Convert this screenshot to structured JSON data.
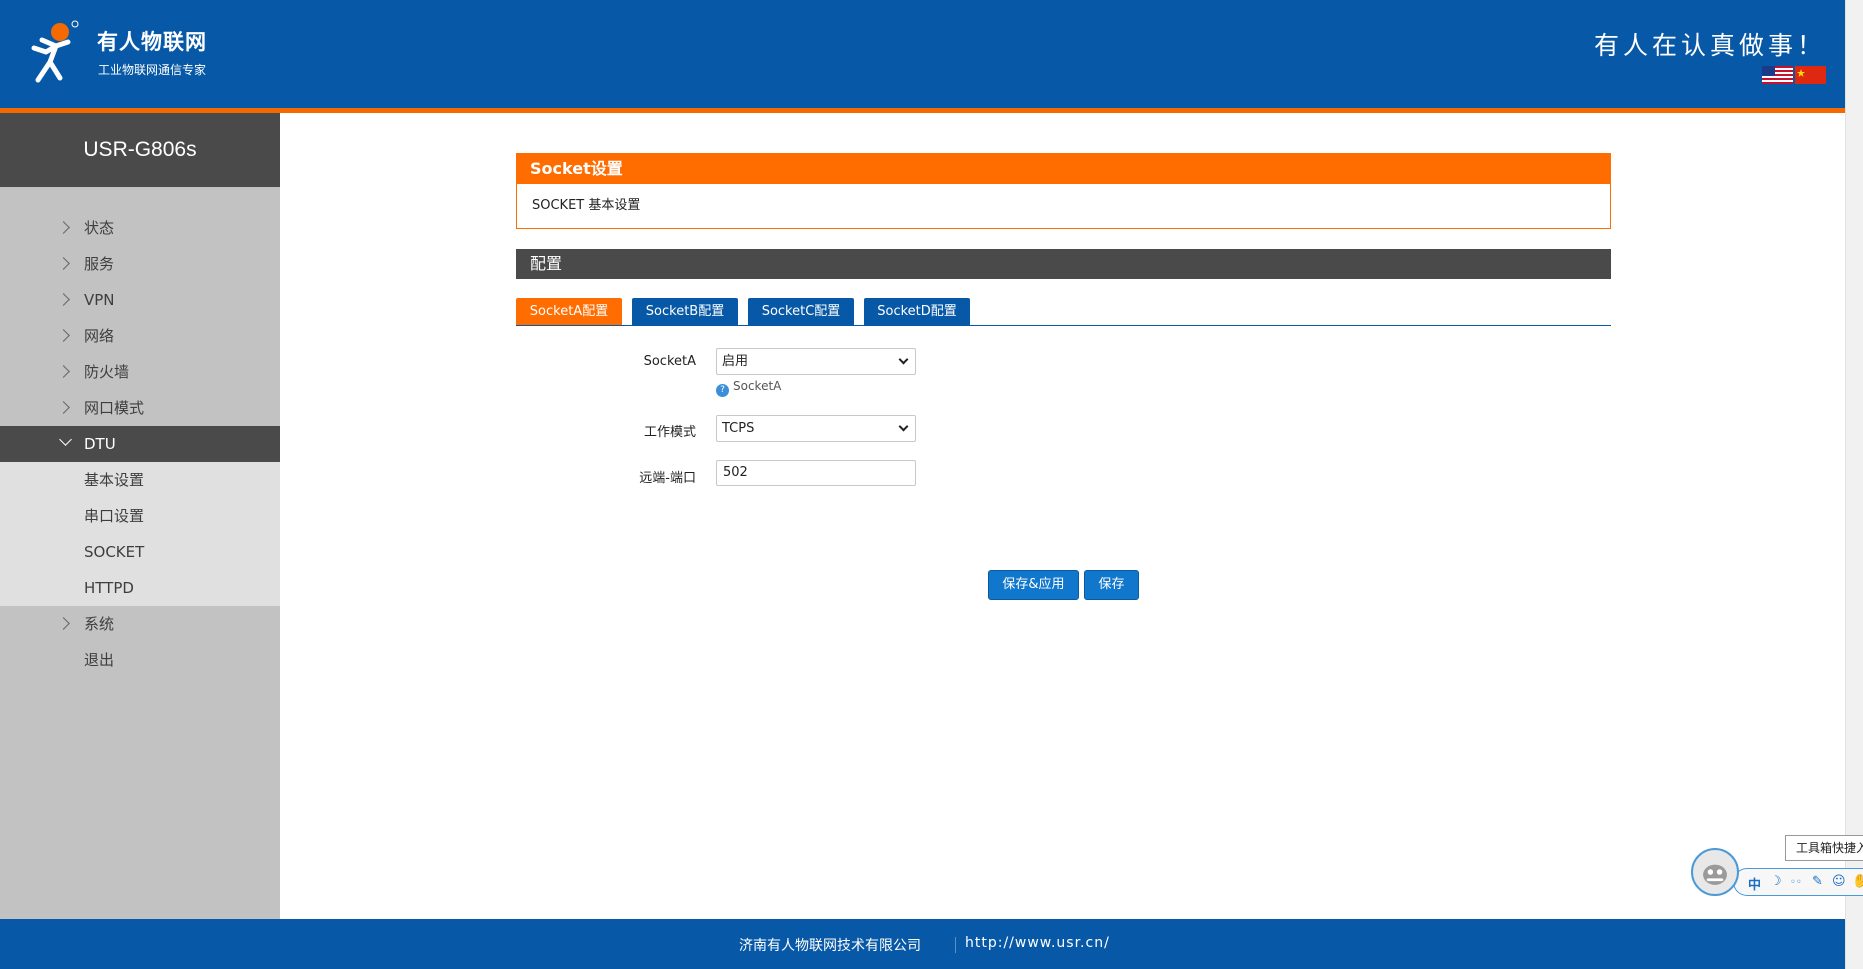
{
  "header": {
    "brand": "有人物联网",
    "brand_sub": "工业物联网通信专家",
    "slogan": "有人在认真做事！",
    "logo_icon": "usr-logo-icon",
    "flags": [
      "us-flag-icon",
      "cn-flag-icon"
    ]
  },
  "sidebar": {
    "device": "USR-G806s",
    "items": [
      {
        "label": "状态"
      },
      {
        "label": "服务"
      },
      {
        "label": "VPN"
      },
      {
        "label": "网络"
      },
      {
        "label": "防火墙"
      },
      {
        "label": "网口模式"
      },
      {
        "label": "DTU"
      },
      {
        "label": "系统"
      },
      {
        "label": "退出"
      }
    ],
    "sub_items": [
      {
        "label": "基本设置"
      },
      {
        "label": "串口设置"
      },
      {
        "label": "SOCKET"
      },
      {
        "label": "HTTPD"
      }
    ]
  },
  "main": {
    "panel_title": "Socket设置",
    "panel_desc": "SOCKET 基本设置",
    "config_title": "配置",
    "tabs": [
      {
        "label": "SocketA配置"
      },
      {
        "label": "SocketB配置"
      },
      {
        "label": "SocketC配置"
      },
      {
        "label": "SocketD配置"
      }
    ],
    "form": {
      "socketa_label": "SocketA",
      "socketa_value": "启用",
      "socketa_hint": "SocketA",
      "mode_label": "工作模式",
      "mode_value": "TCPS",
      "port_label": "远端-端口",
      "port_value": "502"
    },
    "buttons": {
      "save_apply": "保存&应用",
      "save": "保存"
    }
  },
  "footer": {
    "company": "济南有人物联网技术有限公司",
    "url": "http://www.usr.cn/"
  },
  "toolbox": {
    "tip": "工具箱快捷入",
    "icons": [
      "中",
      "☽",
      "◦◦",
      "✎",
      "☺",
      "✋"
    ]
  },
  "colors": {
    "header_blue": "#0758a6",
    "accent_orange": "#ff6c00",
    "dark_gray": "#4a4a4a",
    "sidebar_gray": "#c2c2c2",
    "button_blue": "#1177cc"
  }
}
